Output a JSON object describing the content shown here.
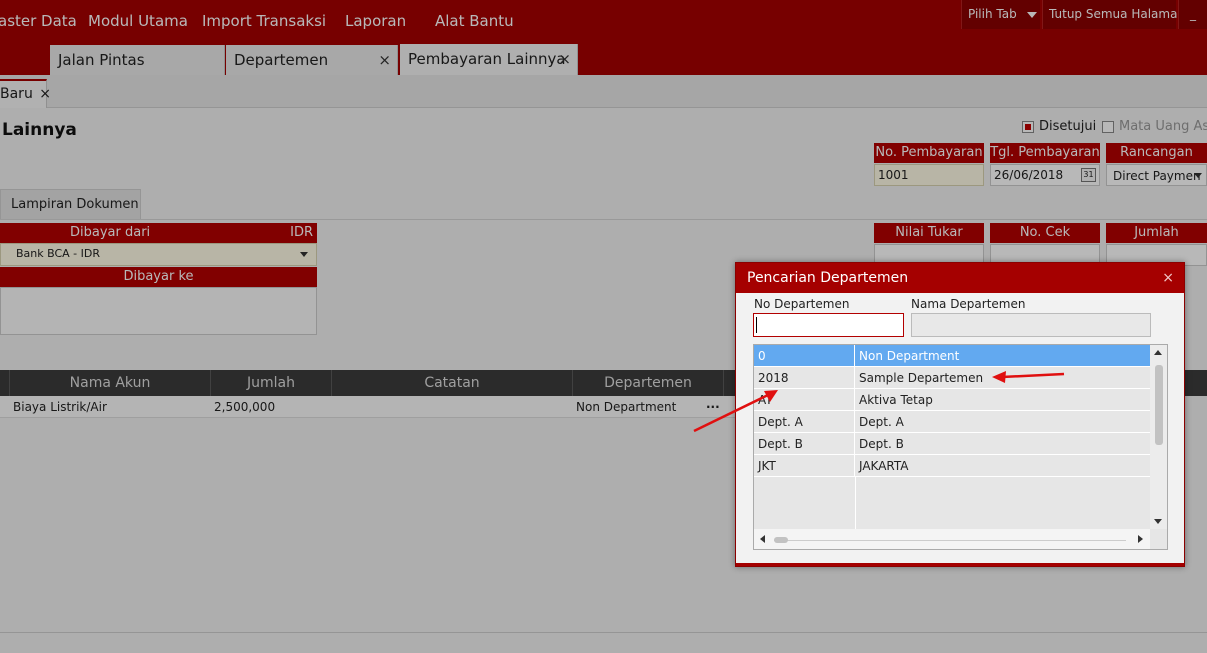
{
  "menu": {
    "items": [
      "aster Data",
      "Modul Utama",
      "Import Transaksi",
      "Laporan",
      "Alat Bantu"
    ],
    "pick_tab": "Pilih Tab",
    "close_all": "Tutup Semua Halaman",
    "minimize": "_"
  },
  "tabs": [
    {
      "label": "Jalan Pintas",
      "closable": false
    },
    {
      "label": "Departemen",
      "closable": true
    },
    {
      "label": "Pembayaran Lainnya",
      "closable": true
    }
  ],
  "tab_close_glyph": "×",
  "subtab": {
    "label": "Baru"
  },
  "form": {
    "title": "Lainnya",
    "approved_label": "Disetujui",
    "currency_label": "Mata Uang Asi",
    "payment_no": {
      "label": "No. Pembayaran",
      "value": "1001"
    },
    "payment_date": {
      "label": "Tgl. Pembayaran",
      "value": "26/06/2018"
    },
    "calendar_day": "31",
    "draft": {
      "label": "Rancangan",
      "value": "Direct Paymen"
    },
    "attachment_tab": "Lampiran Dokumen",
    "paid_from": {
      "label": "Dibayar dari",
      "currency": "IDR",
      "value": "Bank BCA - IDR"
    },
    "paid_to": {
      "label": "Dibayar ke"
    },
    "exchange_rate": {
      "label": "Nilai Tukar"
    },
    "check_no": {
      "label": "No. Cek"
    },
    "amount": {
      "label": "Jumlah"
    },
    "table": {
      "headers": [
        "Nama Akun",
        "Jumlah",
        "Catatan",
        "Departemen"
      ],
      "row": {
        "account": "Biaya Listrik/Air",
        "amount": "2,500,000",
        "note": "",
        "department": "Non Department",
        "ellipsis": "···"
      }
    }
  },
  "dialog": {
    "title": "Pencarian Departemen",
    "close": "×",
    "no_label": "No Departemen",
    "name_label": "Nama Departemen",
    "no_value": "",
    "name_value": "",
    "rows": [
      {
        "no": "0",
        "name": "Non Department",
        "selected": true
      },
      {
        "no": "2018",
        "name": "Sample Departemen",
        "selected": false
      },
      {
        "no": "AT",
        "name": "Aktiva Tetap",
        "selected": false
      },
      {
        "no": "Dept. A",
        "name": "Dept. A",
        "selected": false
      },
      {
        "no": "Dept. B",
        "name": "Dept. B",
        "selected": false
      },
      {
        "no": "JKT",
        "name": "JAKARTA",
        "selected": false
      }
    ]
  },
  "colors": {
    "brand": "#a50000",
    "selection": "#62a9f0",
    "annotation": "#e01010"
  }
}
